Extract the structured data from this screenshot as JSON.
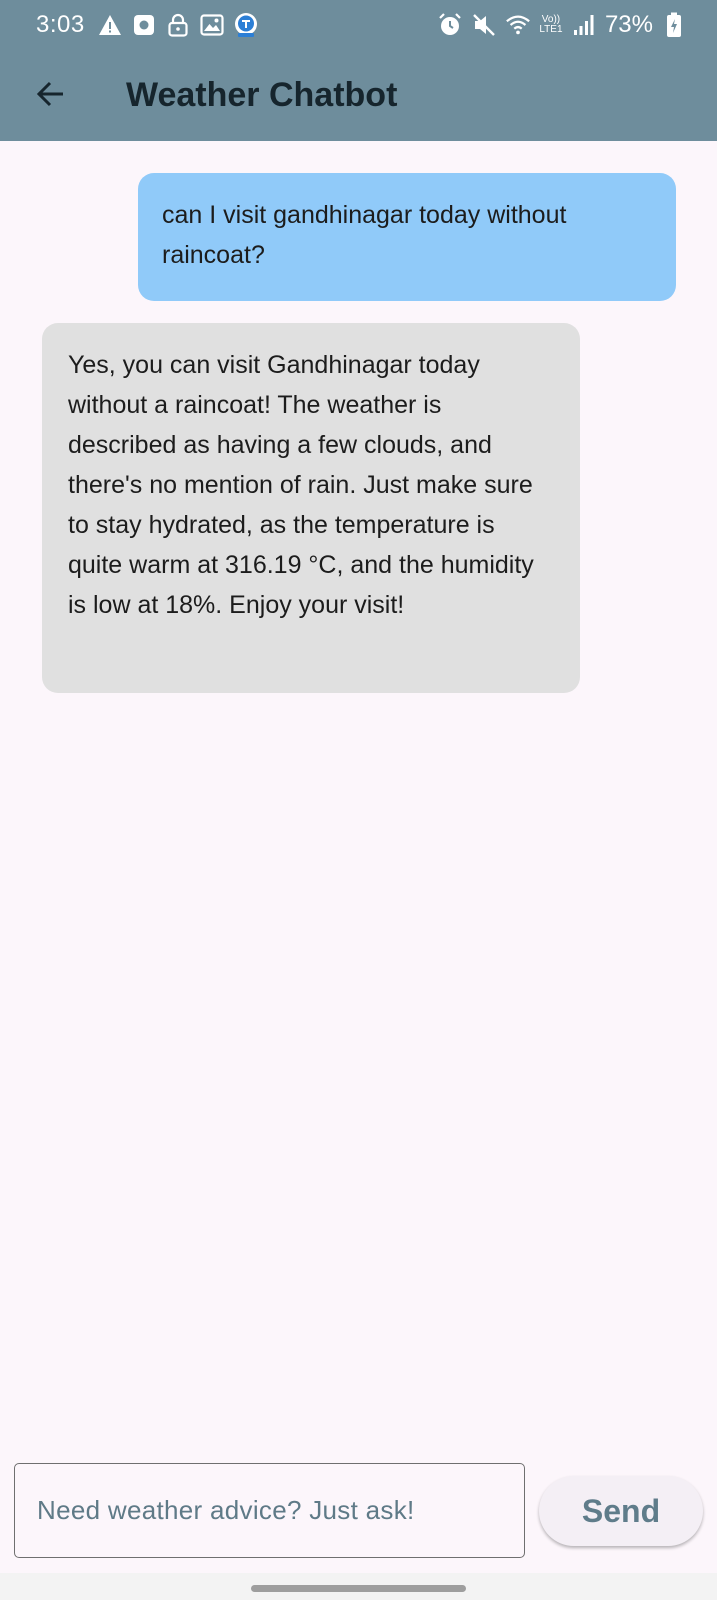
{
  "status_bar": {
    "time": "3:03",
    "volte_top": "Vo))",
    "volte_bottom": "LTE1",
    "battery_percent": "73%",
    "left_icons": [
      "warning-icon",
      "square-notification-icon",
      "lock-icon",
      "image-icon",
      "app-badge-icon"
    ],
    "right_icons": [
      "alarm-icon",
      "mute-icon",
      "wifi-icon",
      "signal-icon",
      "battery-icon"
    ]
  },
  "app_bar": {
    "title": "Weather Chatbot",
    "background": "#6e8d9c"
  },
  "messages": [
    {
      "role": "user",
      "text": "can I visit gandhinagar today without raincoat?",
      "color": "#90caf9"
    },
    {
      "role": "bot",
      "text": "Yes, you can visit Gandhinagar today without a raincoat! The weather is described as having a few clouds, and there's no mention of rain. Just make sure to stay hydrated, as the temperature is quite warm at 316.19 °C, and the humidity is low at 18%. Enjoy your visit!",
      "color": "#e0e0e0"
    }
  ],
  "composer": {
    "placeholder": "Need weather advice? Just ask!",
    "value": "",
    "send_label": "Send"
  }
}
